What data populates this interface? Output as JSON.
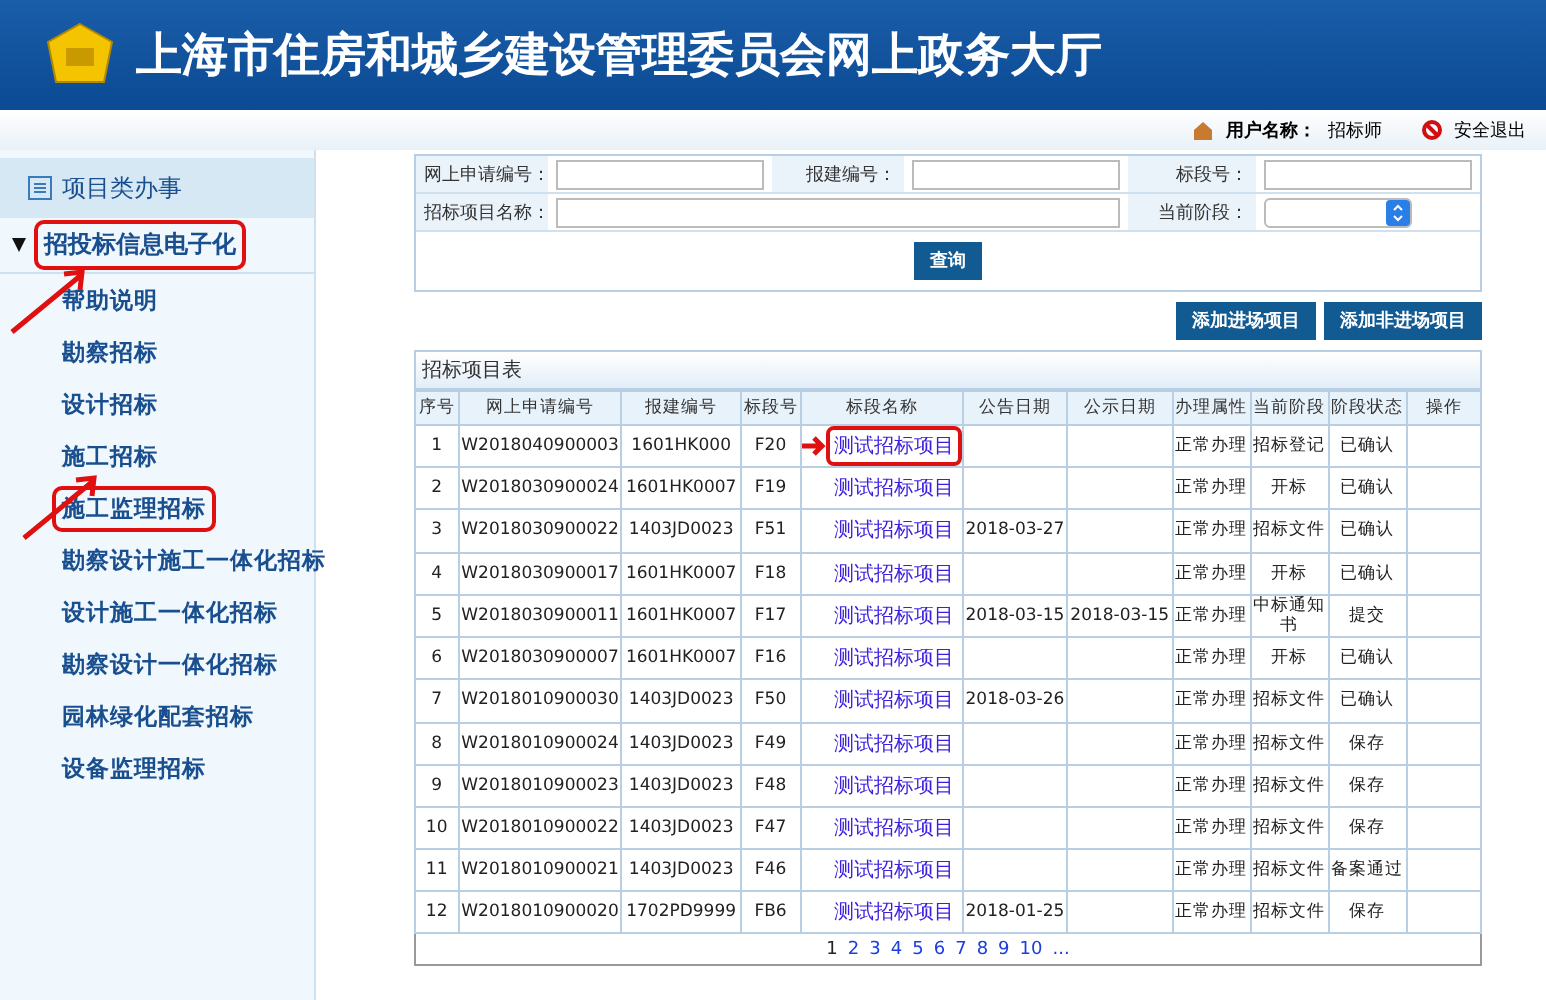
{
  "header": {
    "title": "上海市住房和城乡建设管理委员会网上政务大厅"
  },
  "user_bar": {
    "user_label": "用户名称：",
    "user_name": "招标师",
    "logout": "安全退出"
  },
  "sidebar": {
    "section": "项目类办事",
    "group": {
      "label": "招投标信息电子化",
      "expanded": true,
      "highlighted": true
    },
    "items": [
      {
        "label": "帮助说明",
        "highlighted": false
      },
      {
        "label": "勘察招标",
        "highlighted": false
      },
      {
        "label": "设计招标",
        "highlighted": false
      },
      {
        "label": "施工招标",
        "highlighted": false
      },
      {
        "label": "施工监理招标",
        "highlighted": true
      },
      {
        "label": "勘察设计施工一体化招标",
        "highlighted": false
      },
      {
        "label": "设计施工一体化招标",
        "highlighted": false
      },
      {
        "label": "勘察设计一体化招标",
        "highlighted": false
      },
      {
        "label": "园林绿化配套招标",
        "highlighted": false
      },
      {
        "label": "设备监理招标",
        "highlighted": false
      }
    ]
  },
  "search": {
    "fields": [
      {
        "label": "网上申请编号："
      },
      {
        "label": "报建编号："
      },
      {
        "label": "标段号："
      },
      {
        "label": "招标项目名称："
      },
      {
        "label": "当前阶段："
      }
    ],
    "button": "查询"
  },
  "actions": [
    "添加进场项目",
    "添加非进场项目"
  ],
  "table": {
    "title": "招标项目表",
    "columns": [
      "序号",
      "网上申请编号",
      "报建编号",
      "标段号",
      "标段名称",
      "公告日期",
      "公示日期",
      "办理属性",
      "当前阶段",
      "阶段状态",
      "操作"
    ],
    "rows": [
      {
        "cells": [
          "1",
          "W2018040900003",
          "1601HK000",
          "F20",
          "测试招标项目",
          "",
          "",
          "正常办理",
          "招标登记",
          "已确认",
          ""
        ],
        "highlighted": true
      },
      {
        "cells": [
          "2",
          "W2018030900024",
          "1601HK0007",
          "F19",
          "测试招标项目",
          "",
          "",
          "正常办理",
          "开标",
          "已确认",
          ""
        ],
        "highlighted": false
      },
      {
        "cells": [
          "3",
          "W2018030900022",
          "1403JD0023",
          "F51",
          "测试招标项目",
          "2018-03-27",
          "",
          "正常办理",
          "招标文件",
          "已确认",
          ""
        ],
        "highlighted": false
      },
      {
        "cells": [
          "4",
          "W2018030900017",
          "1601HK0007",
          "F18",
          "测试招标项目",
          "",
          "",
          "正常办理",
          "开标",
          "已确认",
          ""
        ],
        "highlighted": false
      },
      {
        "cells": [
          "5",
          "W2018030900011",
          "1601HK0007",
          "F17",
          "测试招标项目",
          "2018-03-15",
          "2018-03-15",
          "正常办理",
          "中标通知书",
          "提交",
          ""
        ],
        "highlighted": false
      },
      {
        "cells": [
          "6",
          "W2018030900007",
          "1601HK0007",
          "F16",
          "测试招标项目",
          "",
          "",
          "正常办理",
          "开标",
          "已确认",
          ""
        ],
        "highlighted": false
      },
      {
        "cells": [
          "7",
          "W2018010900030",
          "1403JD0023",
          "F50",
          "测试招标项目",
          "2018-03-26",
          "",
          "正常办理",
          "招标文件",
          "已确认",
          ""
        ],
        "highlighted": false
      },
      {
        "cells": [
          "8",
          "W2018010900024",
          "1403JD0023",
          "F49",
          "测试招标项目",
          "",
          "",
          "正常办理",
          "招标文件",
          "保存",
          ""
        ],
        "highlighted": false
      },
      {
        "cells": [
          "9",
          "W2018010900023",
          "1403JD0023",
          "F48",
          "测试招标项目",
          "",
          "",
          "正常办理",
          "招标文件",
          "保存",
          ""
        ],
        "highlighted": false
      },
      {
        "cells": [
          "10",
          "W2018010900022",
          "1403JD0023",
          "F47",
          "测试招标项目",
          "",
          "",
          "正常办理",
          "招标文件",
          "保存",
          ""
        ],
        "highlighted": false
      },
      {
        "cells": [
          "11",
          "W2018010900021",
          "1403JD0023",
          "F46",
          "测试招标项目",
          "",
          "",
          "正常办理",
          "招标文件",
          "备案通过",
          ""
        ],
        "highlighted": false
      },
      {
        "cells": [
          "12",
          "W2018010900020",
          "1702PD9999",
          "FB6",
          "测试招标项目",
          "2018-01-25",
          "",
          "正常办理",
          "招标文件",
          "保存",
          ""
        ],
        "highlighted": false
      }
    ]
  },
  "pagination": [
    {
      "label": "1",
      "selected": true
    },
    {
      "label": "2",
      "selected": false
    },
    {
      "label": "3",
      "selected": false
    },
    {
      "label": "4",
      "selected": false
    },
    {
      "label": "5",
      "selected": false
    },
    {
      "label": "6",
      "selected": false
    },
    {
      "label": "7",
      "selected": false
    },
    {
      "label": "8",
      "selected": false
    },
    {
      "label": "9",
      "selected": false
    },
    {
      "label": "10",
      "selected": false
    },
    {
      "label": "...",
      "selected": false
    }
  ]
}
